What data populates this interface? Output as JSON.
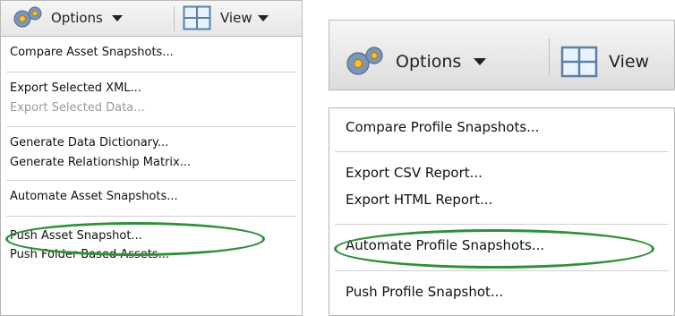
{
  "left_panel": {
    "toolbar": {
      "options_label": "Options",
      "view_label": "View"
    },
    "menu": {
      "compare": "Compare Asset Snapshots...",
      "export_xml": "Export Selected XML...",
      "export_data": "Export Selected Data...",
      "gen_dictionary": "Generate Data Dictionary...",
      "gen_matrix": "Generate Relationship Matrix...",
      "automate": "Automate Asset Snapshots...",
      "push_snapshot": "Push Asset Snapshot...",
      "push_folder": "Push Folder Based Assets..."
    }
  },
  "right_panel": {
    "toolbar": {
      "options_label": "Options",
      "view_label": "View"
    },
    "menu": {
      "compare": "Compare Profile Snapshots...",
      "export_csv": "Export CSV Report...",
      "export_html": "Export HTML Report...",
      "automate": "Automate Profile Snapshots...",
      "push_snapshot": "Push Profile Snapshot..."
    }
  },
  "icons": {
    "options": "gear-icon",
    "view": "grid-layout-icon",
    "dropdown": "caret-down-icon"
  },
  "colors": {
    "highlight_oval": "#2f8f3a",
    "disabled_text": "#9a9a9a"
  }
}
